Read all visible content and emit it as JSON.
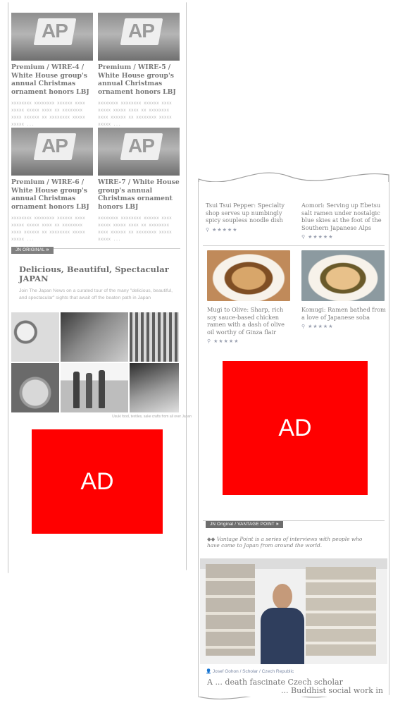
{
  "left_column": {
    "cards": [
      {
        "logo": "AP",
        "title": "Premium / WIRE-4 / White House group's annual Christmas ornament honors LBJ",
        "snippet": "xxxxxxxx xxxxxxxx xxxxxx xxxx xxxxx xxxxx xxxx xx xxxxxxxx xxxx xxxxxx xx xxxxxxxx xxxxx xxxxx ..."
      },
      {
        "logo": "AP",
        "title": "Premium / WIRE-5 / White House group's annual Christmas ornament honors LBJ",
        "snippet": "xxxxxxxx xxxxxxxx xxxxxx xxxx xxxxx xxxxx xxxx xx xxxxxxxx xxxx xxxxxx xx xxxxxxxx xxxxx xxxxx ..."
      },
      {
        "logo": "AP",
        "title": "Premium / WIRE-6 / White House group's annual Christmas ornament honors LBJ",
        "snippet": "xxxxxxxx xxxxxxxx xxxxxx xxxx xxxxx xxxxx xxxx xx xxxxxxxx xxxx xxxxxx xx xxxxxxxx xxxxx xxxxx ..."
      },
      {
        "logo": "AP",
        "title": "WIRE-7 / White House group's annual Christmas ornament honors LBJ",
        "snippet": "xxxxxxxx xxxxxxxx xxxxxx xxxx xxxxx xxxxx xxxx xx xxxxxxxx xxxx xxxxxx xx xxxxxxxx xxxxx xxxxx ..."
      }
    ],
    "section_chip": "JN ORIGINAL",
    "section_title": "Delicious, Beautiful, Spectacular JAPAN",
    "section_text": "Join The Japan News on a curated tour of the many \"delicious, beautiful, and spectacular\" sights that await off the beaten path in Japan",
    "grid_caption": "Usuki food, textiles, sake crafts from all over Japan",
    "ad_label": "AD"
  },
  "right_column": {
    "top_items": [
      {
        "title": "Tsui Tsui Pepper: Specialty shop serves up numbingly spicy soupless noodle dish",
        "stars": "★★★★★"
      },
      {
        "title": "Aomori: Serving up Ebetsu salt ramen under nostalgic blue skies at the foot of the Southern Japanese Alps",
        "stars": "★★★★★"
      }
    ],
    "ramen_items": [
      {
        "title": "Mugi to Olive: Sharp, rich soy sauce-based chicken ramen with a dash of olive oil worthy of Ginza flair",
        "stars": "★★★★★"
      },
      {
        "title": "Komugi: Ramen bathed from a love of Japanese soba",
        "stars": "★★★★★"
      }
    ],
    "ad_label": "AD",
    "vantage_chip": "JN Original / VANTAGE POINT",
    "vantage_intro": "Vantage Point is a series of interviews with people who have come to Japan from around the world.",
    "byline": "Josef Gohon / Scholar / Czech Republic",
    "headline_partial_1": "A ... death fascinate Czech scholar",
    "headline_partial_2": "... Buddhist social work in"
  },
  "colors": {
    "ad": "#ff0000",
    "chip": "#808080",
    "page": "#ffffff"
  }
}
